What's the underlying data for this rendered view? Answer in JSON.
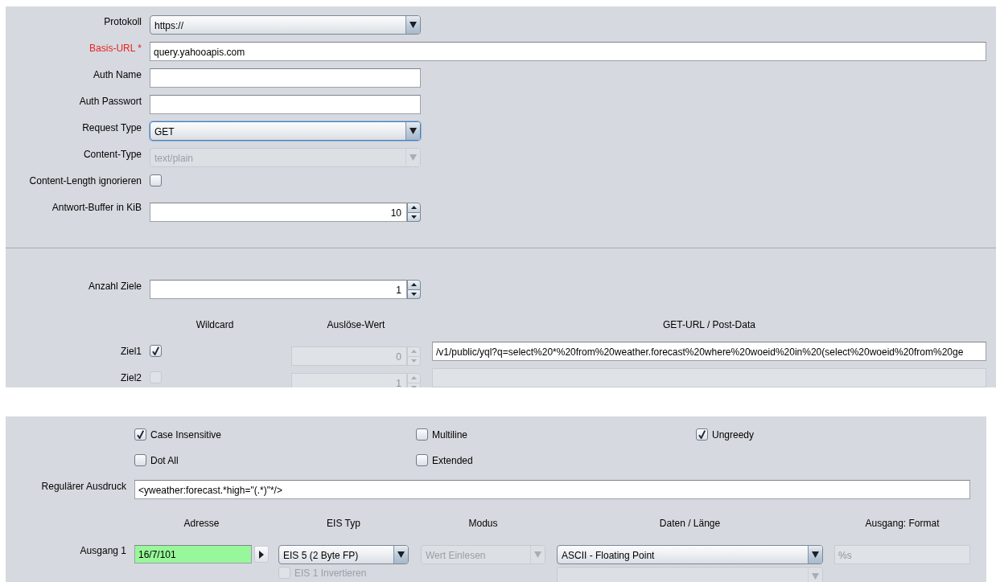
{
  "connection": {
    "fields": [
      {
        "kind": "select",
        "label": "Protokoll",
        "required": false,
        "value": "https://",
        "focused": false,
        "disabled": false
      },
      {
        "kind": "url",
        "label": "Basis-URL *",
        "required": true,
        "value": "query.yahooapis.com"
      },
      {
        "kind": "text",
        "label": "Auth Name",
        "required": false
      },
      {
        "kind": "text",
        "label": "Auth Passwort",
        "required": false
      },
      {
        "kind": "select",
        "label": "Request Type",
        "required": false,
        "value": "GET",
        "focused": true,
        "disabled": false
      },
      {
        "kind": "select",
        "label": "Content-Type",
        "required": false,
        "value": "text/plain",
        "focused": false,
        "disabled": true
      },
      {
        "kind": "checkbox",
        "label": "Content-Length ignorieren",
        "required": false,
        "checked": false
      },
      {
        "kind": "spinner",
        "label": "Antwort-Buffer in KiB",
        "required": false,
        "value": "10"
      }
    ]
  },
  "targets": {
    "count": {
      "label": "Anzahl Ziele",
      "value": "1"
    },
    "columns": [
      "Wildcard",
      "Auslöse-Wert",
      "GET-URL / Post-Data"
    ],
    "rows": [
      {
        "label": "Ziel1",
        "wildcard": {
          "checked": true,
          "disabled": false
        },
        "trigger": {
          "value": "0",
          "disabled": true
        },
        "url": {
          "value": "/v1/public/yql?q=select%20*%20from%20weather.forecast%20where%20woeid%20in%20(select%20woeid%20from%20ge",
          "disabled": false
        }
      },
      {
        "label": "Ziel2",
        "wildcard": {
          "checked": false,
          "disabled": true
        },
        "trigger": {
          "value": "1",
          "disabled": true
        },
        "url": {
          "disabled": true
        }
      }
    ]
  },
  "regex": {
    "options": [
      {
        "label": "Case Insensitive",
        "checked": true
      },
      {
        "label": "Multiline",
        "checked": false
      },
      {
        "label": "Ungreedy",
        "checked": true
      },
      {
        "label": "Dot All",
        "checked": false
      },
      {
        "label": "Extended",
        "checked": false
      }
    ],
    "label": "Regulärer Ausdruck",
    "value": "<yweather:forecast.*high=\"(.*)\"*/>"
  },
  "outputs": {
    "columns": [
      "Adresse",
      "EIS Typ",
      "Modus",
      "Daten / Länge",
      "Ausgang: Format"
    ],
    "rows": [
      {
        "label": "Ausgang 1",
        "address": {
          "value": "16/7/101",
          "valid": true
        },
        "eis_type": {
          "value": "EIS 5 (2 Byte FP)",
          "disabled": false
        },
        "mode": {
          "value": "Wert Einlesen",
          "disabled": true
        },
        "data": {
          "value": "ASCII - Floating Point",
          "disabled": false
        },
        "format": {
          "value": "%s",
          "disabled": true
        },
        "invert": {
          "label": "EIS 1 Invertieren",
          "checked": false,
          "disabled": true
        },
        "length": {
          "disabled": true
        }
      }
    ]
  }
}
